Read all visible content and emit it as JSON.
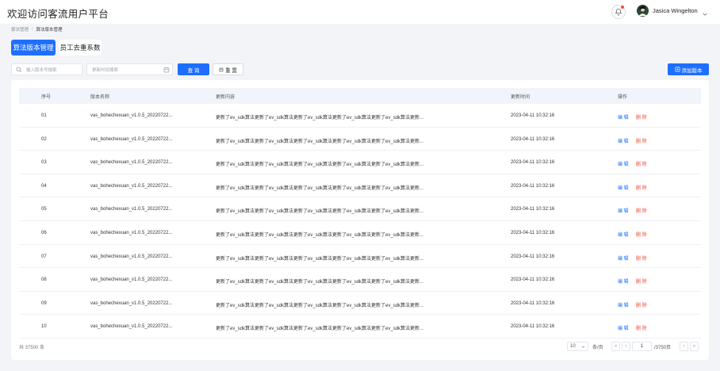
{
  "header": {
    "title": "欢迎访问客流用户平台",
    "user_name": "Jasica Wingelton"
  },
  "breadcrumb": {
    "parent": "算法管理",
    "current": "算法版本管理"
  },
  "tabs": [
    {
      "label": "算法版本管理",
      "active": true
    },
    {
      "label": "员工去重系数",
      "active": false
    }
  ],
  "filters": {
    "search_placeholder": "输入版本号搜索",
    "date_placeholder": "更新时间搜索",
    "query_label": "查 询",
    "reset_label": "重 置",
    "add_label": "添加版本"
  },
  "table": {
    "columns": [
      "序号",
      "版本名称",
      "更新内容",
      "更新时间",
      "操作"
    ],
    "edit_label": "编 辑",
    "delete_label": "删 除",
    "rows": [
      {
        "seq": "01",
        "name": "vas_bohechexuan_v1.0.5_20220722...",
        "content": "更新了ev_sdk算法更新了ev_sdk算法更新了ev_sdk算法更新了ev_sdk算法更新了ev_sdk算法更新...",
        "time": "2023-04-11 10:32:16"
      },
      {
        "seq": "02",
        "name": "vas_bohechexuan_v1.0.5_20220722...",
        "content": "更新了ev_sdk算法更新了ev_sdk算法更新了ev_sdk算法更新了ev_sdk算法更新了ev_sdk算法更新...",
        "time": "2023-04-11 10:32:16"
      },
      {
        "seq": "03",
        "name": "vas_bohechexuan_v1.0.5_20220722...",
        "content": "更新了ev_sdk算法更新了ev_sdk算法更新了ev_sdk算法更新了ev_sdk算法更新了ev_sdk算法更新...",
        "time": "2023-04-11 10:32:16"
      },
      {
        "seq": "04",
        "name": "vas_bohechexuan_v1.0.5_20220722...",
        "content": "更新了ev_sdk算法更新了ev_sdk算法更新了ev_sdk算法更新了ev_sdk算法更新了ev_sdk算法更新...",
        "time": "2023-04-11 10:32:16"
      },
      {
        "seq": "05",
        "name": "vas_bohechexuan_v1.0.5_20220722...",
        "content": "更新了ev_sdk算法更新了ev_sdk算法更新了ev_sdk算法更新了ev_sdk算法更新了ev_sdk算法更新...",
        "time": "2023-04-11 10:32:16"
      },
      {
        "seq": "06",
        "name": "vas_bohechexuan_v1.0.5_20220722...",
        "content": "更新了ev_sdk算法更新了ev_sdk算法更新了ev_sdk算法更新了ev_sdk算法更新了ev_sdk算法更新...",
        "time": "2023-04-11 10:32:16"
      },
      {
        "seq": "07",
        "name": "vas_bohechexuan_v1.0.5_20220722...",
        "content": "更新了ev_sdk算法更新了ev_sdk算法更新了ev_sdk算法更新了ev_sdk算法更新了ev_sdk算法更新...",
        "time": "2023-04-11 10:32:16"
      },
      {
        "seq": "08",
        "name": "vas_bohechexuan_v1.0.5_20220722...",
        "content": "更新了ev_sdk算法更新了ev_sdk算法更新了ev_sdk算法更新了ev_sdk算法更新了ev_sdk算法更新...",
        "time": "2023-04-11 10:32:16"
      },
      {
        "seq": "09",
        "name": "vas_bohechexuan_v1.0.5_20220722...",
        "content": "更新了ev_sdk算法更新了ev_sdk算法更新了ev_sdk算法更新了ev_sdk算法更新了ev_sdk算法更新...",
        "time": "2023-04-11 10:32:16"
      },
      {
        "seq": "10",
        "name": "vas_bohechexuan_v1.0.5_20220722...",
        "content": "更新了ev_sdk算法更新了ev_sdk算法更新了ev_sdk算法更新了ev_sdk算法更新了ev_sdk算法更新...",
        "time": "2023-04-11 10:32:16"
      }
    ]
  },
  "pagination": {
    "total_text": "共 37500 条",
    "page_size": "10",
    "page_size_unit": "条/页",
    "first_glyph": "«",
    "prev_glyph": "‹",
    "current_page": "1",
    "total_pages": "/3750页",
    "next_glyph": "›",
    "last_glyph": "»"
  },
  "colors": {
    "primary": "#1e6fff",
    "danger": "#f04d3c",
    "background": "#f3f4f7"
  },
  "icons": [
    "bell-icon",
    "avatar",
    "chevron-down-icon",
    "search-icon",
    "calendar-icon",
    "reset-icon",
    "add-icon"
  ]
}
